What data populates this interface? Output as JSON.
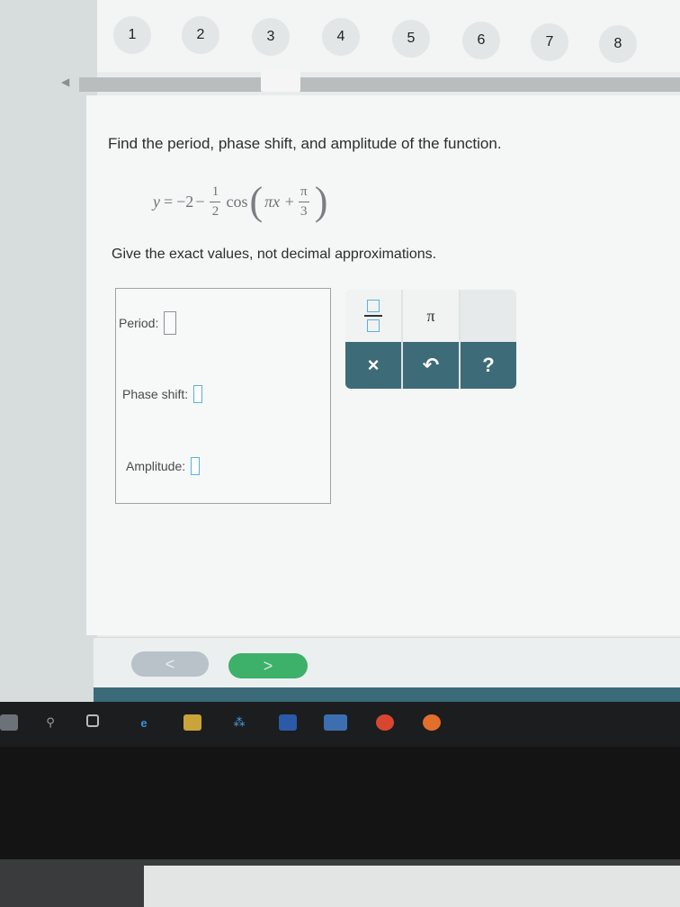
{
  "question_nav": {
    "numbers": [
      "1",
      "2",
      "3",
      "4",
      "5",
      "6",
      "7",
      "8"
    ],
    "current": "3"
  },
  "problem": {
    "prompt": "Find the period, phase shift, and amplitude of the function.",
    "equation": {
      "lhs": "y",
      "equals": "=",
      "constant": "−2",
      "minus": "−",
      "coef_numerator": "1",
      "coef_denominator": "2",
      "func": "cos",
      "inner": "πx +",
      "shift_numerator": "π",
      "shift_denominator": "3"
    },
    "instructions": "Give the exact values, not decimal approximations."
  },
  "answers": {
    "period_label": "Period:",
    "phase_shift_label": "Phase shift:",
    "amplitude_label": "Amplitude:"
  },
  "keypad": {
    "pi": "π",
    "clear": "×",
    "undo": "↶",
    "help": "?"
  },
  "footer": {
    "prev": "<",
    "next": ">"
  },
  "colors": {
    "accent_green": "#3db06a",
    "keypad_dark": "#3d6b78",
    "field_blue": "#5ab0e0"
  }
}
